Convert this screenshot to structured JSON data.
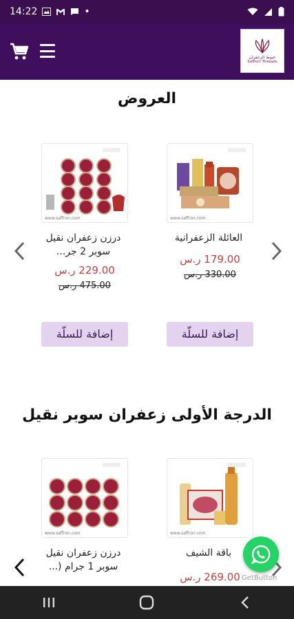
{
  "status_bar": {
    "time": "14:22",
    "dot": "•",
    "icons_left": [
      "image-icon",
      "gmail-icon",
      "message-icon"
    ],
    "icons_right": [
      "wifi-icon",
      "signal-icon",
      "battery-icon"
    ]
  },
  "app_bar": {
    "logo_ar": "خيوط الزعفران",
    "logo_en": "Saffron Threads",
    "cart_icon": "cart-icon",
    "menu_icon": "menu-icon"
  },
  "offers": {
    "title": "العروض",
    "products": [
      {
        "name": "العائلة الزعفرانية",
        "price_new": "179.00 ر.س",
        "price_old": "330.00 ر.س",
        "button": "إضافة للسلّة",
        "watermark": "www.saffron.com"
      },
      {
        "name": "درزن زعفران نقيل سوبر 2 جر...",
        "price_new": "229.00 ر.س",
        "price_old": "475.00 ر.س",
        "button": "إضافة للسلّة",
        "watermark": "www.saffron.com"
      }
    ]
  },
  "premium": {
    "title": "الدرجة الأولى زعفران سوبر نقيل",
    "products": [
      {
        "name": "باقة الشيف",
        "price_new": "269.00 ر.س",
        "watermark": "www.saffron.com"
      },
      {
        "name": "درزن زعفران نقيل سوبر 1 جرام (...",
        "watermark": "www.saffron.com"
      }
    ]
  },
  "whatsapp": {
    "label": "GetButton",
    "icon": "whatsapp-icon"
  },
  "nav": {
    "icons": [
      "recents-icon",
      "home-icon",
      "back-icon"
    ]
  },
  "colors": {
    "app_bar": "#3f0f5e",
    "status_bar": "#3b0f4f",
    "price_new": "#c2413e",
    "button_bg": "#e4d3ef",
    "whatsapp": "#25d366"
  }
}
